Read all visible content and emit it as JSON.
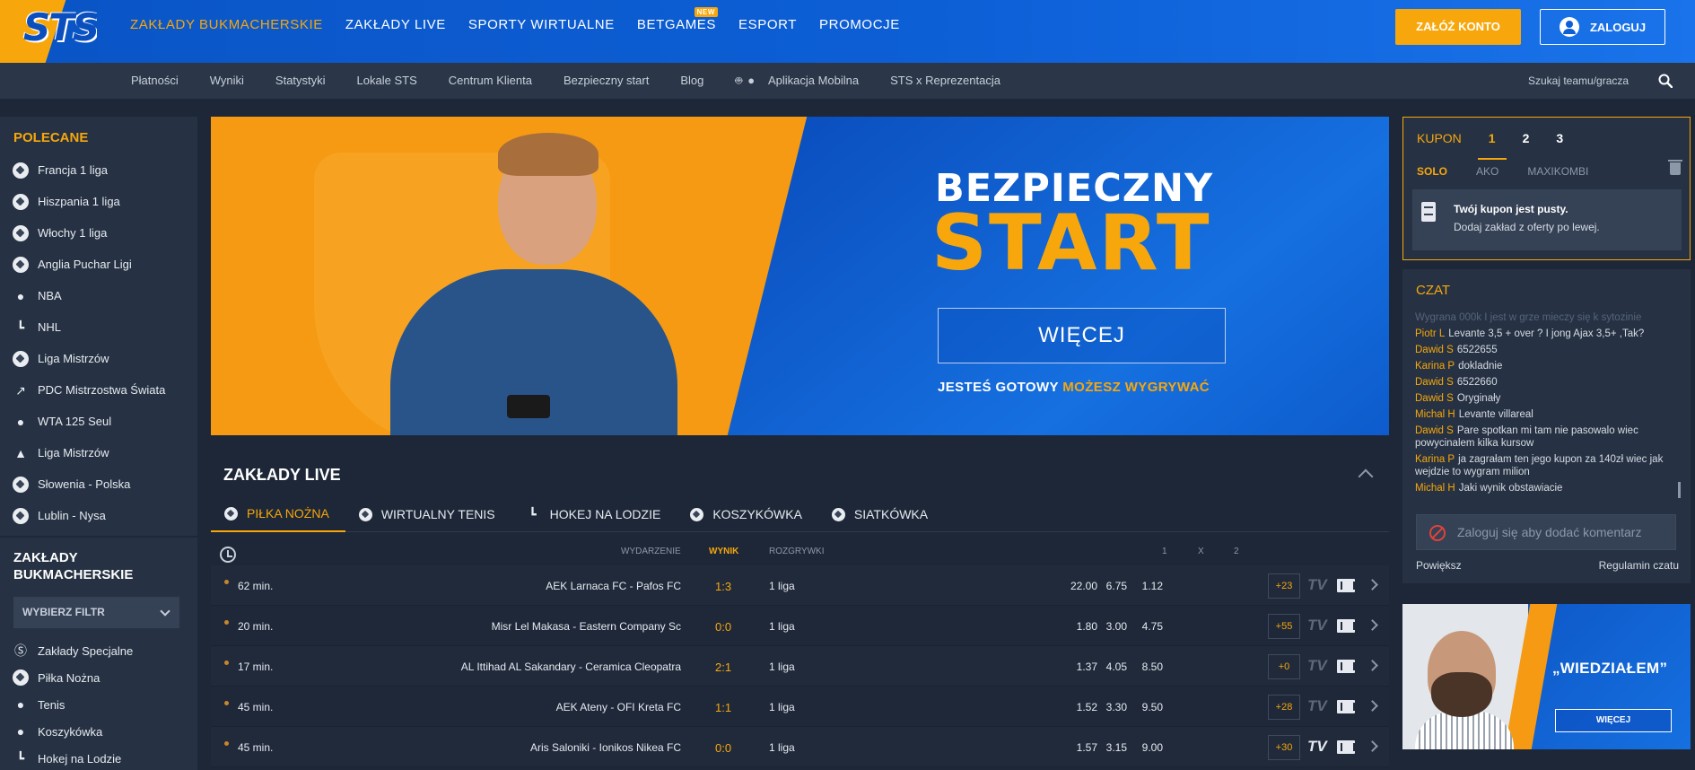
{
  "header": {
    "logo_text": "STS",
    "nav": [
      {
        "label": "ZAKŁADY BUKMACHERSKIE",
        "active": true
      },
      {
        "label": "ZAKŁADY LIVE"
      },
      {
        "label": "SPORTY WIRTUALNE"
      },
      {
        "label": "BETGAMES",
        "badge": "NEW"
      },
      {
        "label": "ESPORT"
      },
      {
        "label": "PROMOCJE"
      }
    ],
    "register_label": "ZAŁÓŻ KONTO",
    "login_label": "ZALOGUJ"
  },
  "subnav": {
    "items": [
      "Płatności",
      "Wyniki",
      "Statystyki",
      "Lokale STS",
      "Centrum Klienta",
      "Bezpieczny start",
      "Blog",
      "Aplikacja Mobilna",
      "STS x Reprezentacja"
    ],
    "search_placeholder": "Szukaj teamu/gracza"
  },
  "sidebar": {
    "recommended_title": "POLECANE",
    "recommended": [
      {
        "label": "Francja 1 liga",
        "icon": "football-icon"
      },
      {
        "label": "Hiszpania 1 liga",
        "icon": "football-icon"
      },
      {
        "label": "Włochy 1 liga",
        "icon": "football-icon"
      },
      {
        "label": "Anglia Puchar Ligi",
        "icon": "football-icon"
      },
      {
        "label": "NBA",
        "icon": "basketball-icon"
      },
      {
        "label": "NHL",
        "icon": "hockey-icon"
      },
      {
        "label": "Liga Mistrzów",
        "icon": "volleyball-icon"
      },
      {
        "label": "PDC Mistrzostwa Świata",
        "icon": "darts-icon"
      },
      {
        "label": "WTA 125 Seul",
        "icon": "tennis-icon"
      },
      {
        "label": "Liga Mistrzów",
        "icon": "handball-icon"
      },
      {
        "label": "Słowenia - Polska",
        "icon": "volleyball-icon"
      },
      {
        "label": "Lublin - Nysa",
        "icon": "volleyball-icon"
      }
    ],
    "bets_title": "ZAKŁADY BUKMACHERSKIE",
    "filter_label": "WYBIERZ FILTR",
    "categories": [
      {
        "label": "Zakłady Specjalne",
        "icon": "special-bets-icon"
      },
      {
        "label": "Piłka Nożna",
        "icon": "football-icon"
      },
      {
        "label": "Tenis",
        "icon": "tennis-icon"
      },
      {
        "label": "Koszykówka",
        "icon": "basketball-icon"
      },
      {
        "label": "Hokej na Lodzie",
        "icon": "hockey-icon"
      }
    ]
  },
  "banner": {
    "title_line1": "BEZPIECZNY",
    "title_line2": "START",
    "button_label": "WIĘCEJ",
    "tagline_white": "JESTEŚ GOTOWY",
    "tagline_orange": "MOŻESZ WYGRYWAĆ"
  },
  "live": {
    "title": "ZAKŁADY LIVE",
    "tabs": [
      {
        "label": "PIŁKA NOŻNA",
        "active": true
      },
      {
        "label": "WIRTUALNY TENIS"
      },
      {
        "label": "HOKEJ NA LODZIE"
      },
      {
        "label": "KOSZYKÓWKA"
      },
      {
        "label": "SIATKÓWKA"
      }
    ],
    "columns": {
      "event": "WYDARZENIE",
      "score": "WYNIK",
      "competition": "ROZGRYWKI",
      "odd1": "1",
      "oddx": "X",
      "odd2": "2"
    },
    "matches": [
      {
        "time": "62 min.",
        "event": "AEK Larnaca FC - Pafos FC",
        "score": "1:3",
        "league": "1 liga",
        "o1": "22.00",
        "ox": "6.75",
        "o2": "1.12",
        "more": "+23",
        "tv_active": false
      },
      {
        "time": "20 min.",
        "event": "Misr Lel Makasa - Eastern Company Sc",
        "score": "0:0",
        "league": "1 liga",
        "o1": "1.80",
        "ox": "3.00",
        "o2": "4.75",
        "more": "+55",
        "tv_active": false
      },
      {
        "time": "17 min.",
        "event": "AL Ittihad AL Sakandary - Ceramica Cleopatra",
        "score": "2:1",
        "league": "1 liga",
        "o1": "1.37",
        "ox": "4.05",
        "o2": "8.50",
        "more": "+0",
        "tv_active": false
      },
      {
        "time": "45 min.",
        "event": "AEK Ateny - OFI Kreta FC",
        "score": "1:1",
        "league": "1 liga",
        "o1": "1.52",
        "ox": "3.30",
        "o2": "9.50",
        "more": "+28",
        "tv_active": false
      },
      {
        "time": "45 min.",
        "event": "Aris Saloniki - Ionikos Nikea FC",
        "score": "0:0",
        "league": "1 liga",
        "o1": "1.57",
        "ox": "3.15",
        "o2": "9.00",
        "more": "+30",
        "tv_active": true
      }
    ],
    "tv_label": "TV"
  },
  "coupon": {
    "title": "KUPON",
    "tabs": [
      "1",
      "2",
      "3"
    ],
    "modes": [
      "SOLO",
      "AKO",
      "MAXIKOMBI"
    ],
    "empty_title": "Twój kupon jest pusty.",
    "empty_text": "Dodaj zakład z oferty po lewej."
  },
  "chat": {
    "title": "CZAT",
    "faded_line": "Wygrana 000k I jest w grze mieczy się k sytozinie",
    "messages": [
      {
        "user": "Piotr L",
        "text": "Levante 3,5 + over ? I jong Ajax 3,5+ ,Tak?"
      },
      {
        "user": "Dawid S",
        "text": "6522655"
      },
      {
        "user": "Karina P",
        "text": "dokladnie"
      },
      {
        "user": "Dawid S",
        "text": "6522660"
      },
      {
        "user": "Dawid S",
        "text": "Oryginały"
      },
      {
        "user": "Michal H",
        "text": "Levante villareal"
      },
      {
        "user": "Dawid S",
        "text": "Pare spotkan mi tam nie pasowalo wiec powycinalem kilka kursow"
      },
      {
        "user": "Karina P",
        "text": "ja zagrałam ten jego kupon za 140zł wiec jak wejdzie to wygram milion"
      },
      {
        "user": "Michal H",
        "text": "Jaki wynik obstawiacie"
      }
    ],
    "input_placeholder": "Zaloguj się aby dodać komentarz",
    "enlarge_label": "Powiększ",
    "rules_label": "Regulamin czatu"
  },
  "promo": {
    "title": "„WIEDZIAŁEM”",
    "button_label": "WIĘCEJ"
  },
  "colors": {
    "accent": "#f7a70b",
    "brand_blue": "#0d5fd6",
    "bg": "#1d2737",
    "panel": "#263243"
  }
}
